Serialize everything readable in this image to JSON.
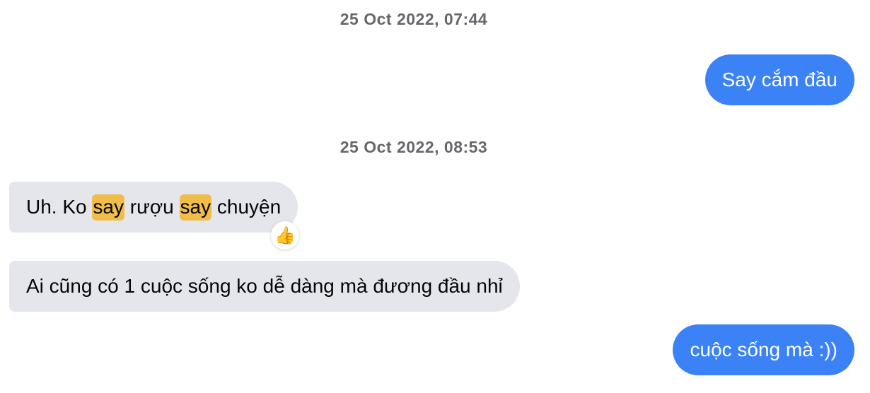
{
  "timestamps": {
    "first": "25 Oct 2022, 07:44",
    "second": "25 Oct 2022, 08:53"
  },
  "messages": [
    {
      "direction": "outgoing",
      "text": "Say cắm đầu"
    },
    {
      "direction": "incoming",
      "parts": [
        "Uh. Ko ",
        "say",
        " rượu ",
        "say",
        " chuyện"
      ],
      "highlighted_term": "say",
      "reaction": "👍"
    },
    {
      "direction": "incoming",
      "text": "Ai cũng có 1 cuộc sống ko dễ dàng mà đương đầu nhỉ"
    },
    {
      "direction": "outgoing",
      "text": "cuộc sống mà :))"
    }
  ],
  "colors": {
    "outgoing_bubble": "#3b82f6",
    "incoming_bubble": "#e4e6eb",
    "highlight": "#f0bd4b",
    "timestamp": "#65676b"
  }
}
